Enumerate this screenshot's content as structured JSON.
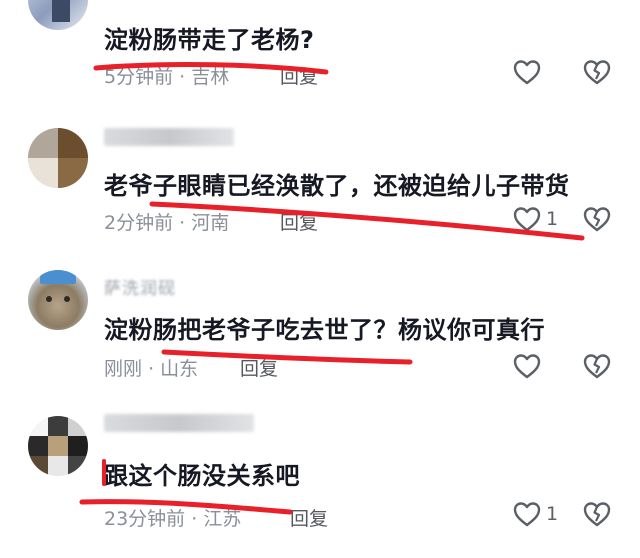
{
  "comments": [
    {
      "username": "",
      "text": "淀粉肠带走了老杨?",
      "time": "5分钟前",
      "location": "吉林",
      "reply_label": "回复",
      "like_count": ""
    },
    {
      "username": "",
      "text": "老爷子眼睛已经涣散了，还被迫给儿子带货",
      "time": "2分钟前",
      "location": "河南",
      "reply_label": "回复",
      "like_count": "1"
    },
    {
      "username": "萨洗润砚",
      "text": "淀粉肠把老爷子吃去世了？杨议你可真行",
      "time": "刚刚",
      "location": "山东",
      "reply_label": "回复",
      "like_count": ""
    },
    {
      "username": "",
      "text": "跟这个肠没关系吧",
      "time": "23分钟前",
      "location": "江苏",
      "reply_label": "回复",
      "like_count": "1"
    }
  ],
  "icons": {
    "like": "heart-outline-icon",
    "dislike": "broken-heart-icon"
  },
  "colors": {
    "text": "#161823",
    "meta": "#8a8f99",
    "annotation_red": "#e8202a"
  }
}
